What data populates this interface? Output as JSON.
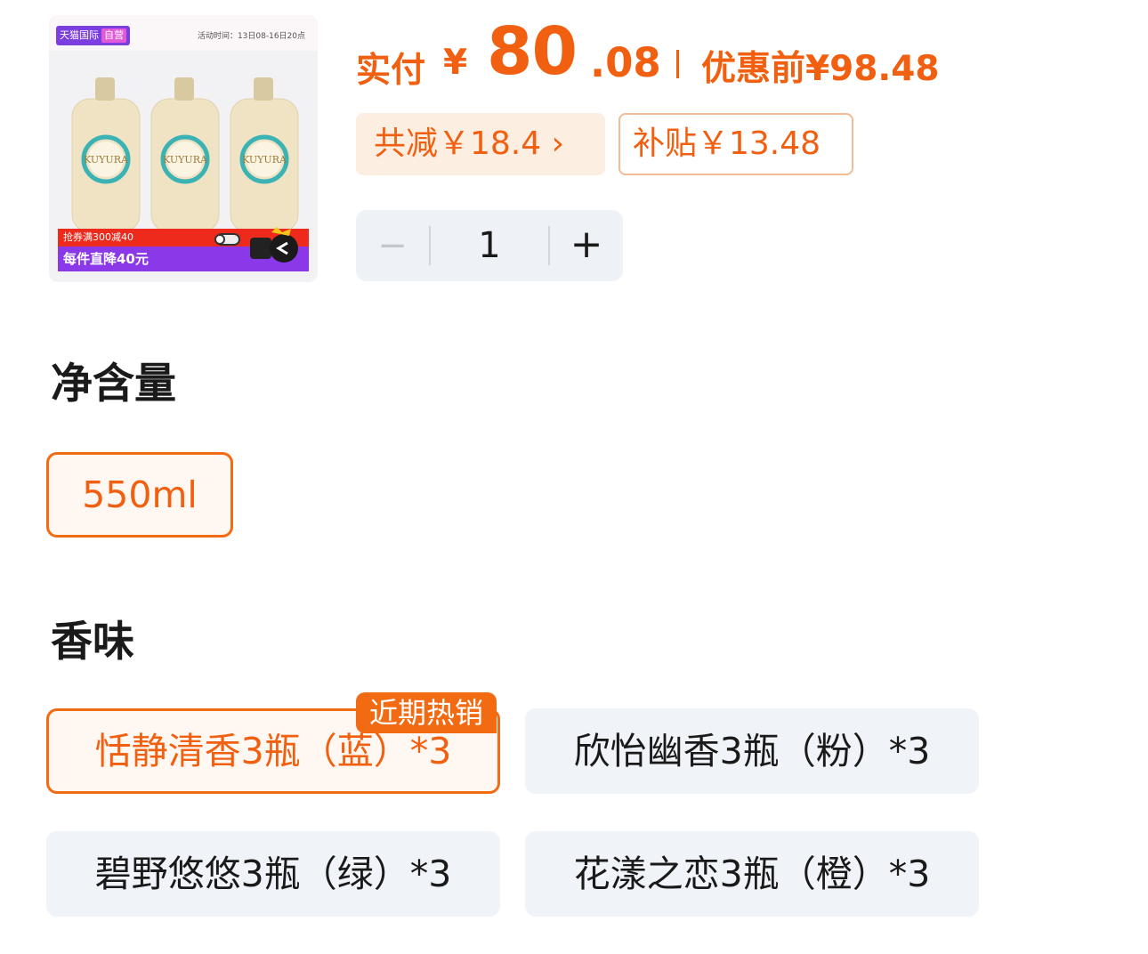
{
  "product": {
    "image_alt": "KUYURA 沐浴露 3瓶装",
    "brand_badge": "天猫国际",
    "brand_badge_sub": "自营",
    "event_time_label": "活动时间：13日08-16日20点",
    "bottle_brand": "KUYURA",
    "promo_line1": "抢券满300减40",
    "promo_line2": "每件直降40元"
  },
  "price": {
    "label": "实付",
    "currency": "¥",
    "integer": "80",
    "decimal": ".08",
    "original_label": "优惠前",
    "original_value": "¥98.48"
  },
  "discounts": {
    "total_reduction": "共减￥18.4 ›",
    "subsidy": "补贴￥13.48"
  },
  "quantity": {
    "minus": "−",
    "value": "1",
    "plus": "+"
  },
  "volume": {
    "title": "净含量",
    "options": [
      "550ml"
    ],
    "selected": "550ml"
  },
  "scent": {
    "title": "香味",
    "hot_badge": "近期热销",
    "options": [
      "恬静清香3瓶（蓝）*3",
      "欣怡幽香3瓶（粉）*3",
      "碧野悠悠3瓶（绿）*3",
      "花漾之恋3瓶（橙）*3"
    ],
    "selected": "恬静清香3瓶（蓝）*3"
  },
  "colors": {
    "accent": "#f06010",
    "selected_border": "#f26a12",
    "option_bg": "#f0f3f7",
    "chip_bg": "#fdeee2"
  }
}
